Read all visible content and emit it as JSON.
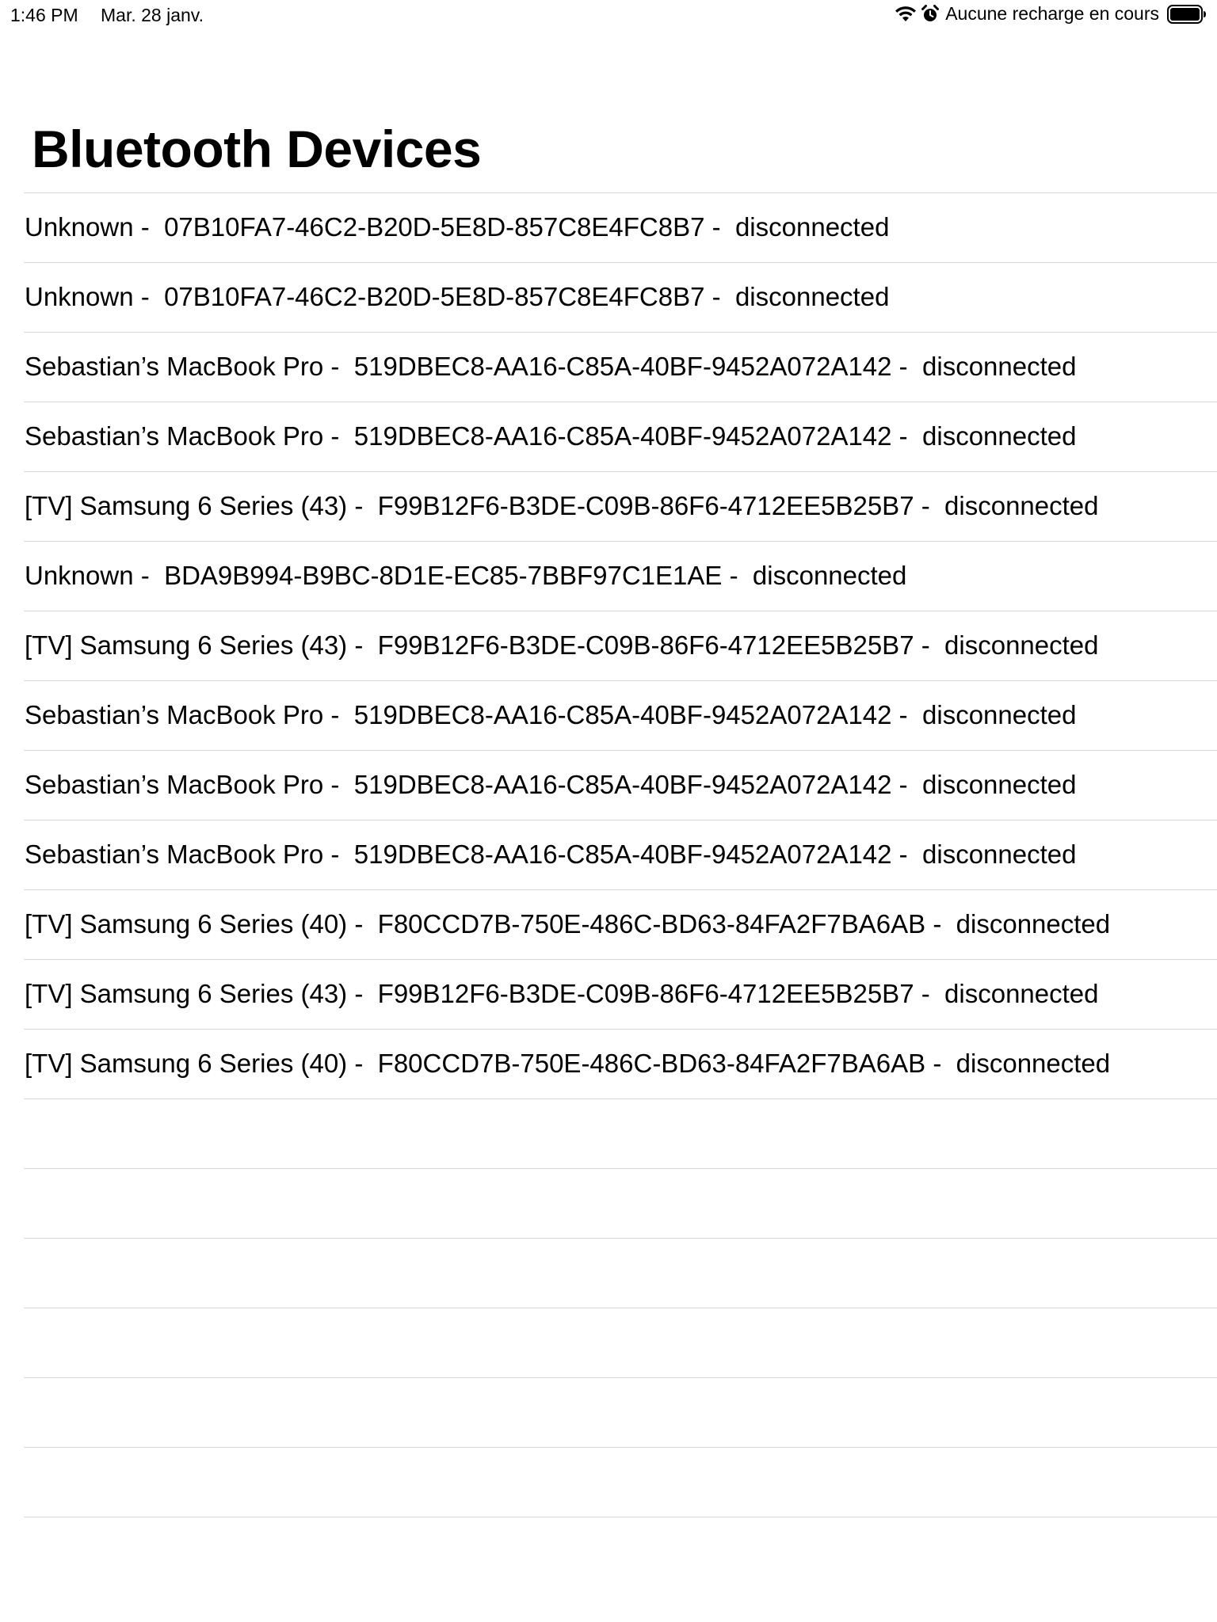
{
  "status_bar": {
    "time": "1:46 PM",
    "date": "Mar. 28 janv.",
    "charging_text": "Aucune recharge en cours",
    "icons": [
      "wifi-icon",
      "alarm-icon",
      "battery-icon"
    ]
  },
  "page": {
    "title": "Bluetooth Devices"
  },
  "devices": [
    {
      "text": "Unknown -  07B10FA7-46C2-B20D-5E8D-857C8E4FC8B7 -  disconnected"
    },
    {
      "text": "Unknown -  07B10FA7-46C2-B20D-5E8D-857C8E4FC8B7 -  disconnected"
    },
    {
      "text": "Sebastian’s MacBook Pro -  519DBEC8-AA16-C85A-40BF-9452A072A142 -  disconnected"
    },
    {
      "text": "Sebastian’s MacBook Pro -  519DBEC8-AA16-C85A-40BF-9452A072A142 -  disconnected"
    },
    {
      "text": "[TV] Samsung 6 Series (43) -  F99B12F6-B3DE-C09B-86F6-4712EE5B25B7 -  disconnected"
    },
    {
      "text": "Unknown -  BDA9B994-B9BC-8D1E-EC85-7BBF97C1E1AE -  disconnected"
    },
    {
      "text": "[TV] Samsung 6 Series (43) -  F99B12F6-B3DE-C09B-86F6-4712EE5B25B7 -  disconnected"
    },
    {
      "text": "Sebastian’s MacBook Pro -  519DBEC8-AA16-C85A-40BF-9452A072A142 -  disconnected"
    },
    {
      "text": "Sebastian’s MacBook Pro -  519DBEC8-AA16-C85A-40BF-9452A072A142 -  disconnected"
    },
    {
      "text": "Sebastian’s MacBook Pro -  519DBEC8-AA16-C85A-40BF-9452A072A142 -  disconnected"
    },
    {
      "text": "[TV] Samsung 6 Series (40) -  F80CCD7B-750E-486C-BD63-84FA2F7BA6AB -  disconnected"
    },
    {
      "text": "[TV] Samsung 6 Series (43) -  F99B12F6-B3DE-C09B-86F6-4712EE5B25B7 -  disconnected"
    },
    {
      "text": "[TV] Samsung 6 Series (40) -  F80CCD7B-750E-486C-BD63-84FA2F7BA6AB -  disconnected"
    },
    {
      "text": ""
    },
    {
      "text": ""
    },
    {
      "text": ""
    },
    {
      "text": ""
    },
    {
      "text": ""
    },
    {
      "text": ""
    },
    {
      "text": ""
    }
  ]
}
